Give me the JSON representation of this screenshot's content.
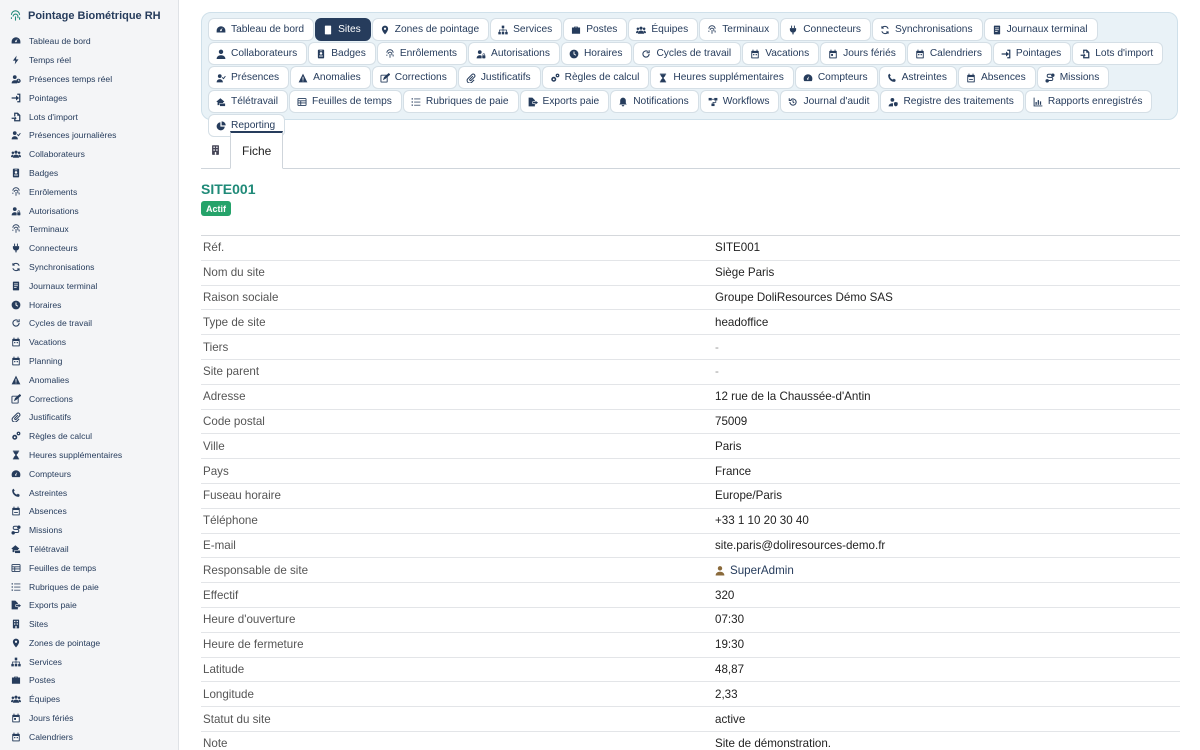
{
  "app": {
    "title": "Pointage Biométrique RH",
    "accent": "#263c5c",
    "brand_color": "#1f8a78"
  },
  "sidebar": {
    "items": [
      {
        "label": "Tableau de bord",
        "icon": "dashboard-icon"
      },
      {
        "label": "Temps réel",
        "icon": "bolt-icon"
      },
      {
        "label": "Présences temps réel",
        "icon": "user-clock-icon"
      },
      {
        "label": "Pointages",
        "icon": "sign-in-icon"
      },
      {
        "label": "Lots d'import",
        "icon": "file-import-icon"
      },
      {
        "label": "Présences journalières",
        "icon": "user-check-icon"
      },
      {
        "label": "Collaborateurs",
        "icon": "users-icon"
      },
      {
        "label": "Badges",
        "icon": "id-badge-icon"
      },
      {
        "label": "Enrôlements",
        "icon": "fingerprint-icon"
      },
      {
        "label": "Autorisations",
        "icon": "user-lock-icon"
      },
      {
        "label": "Terminaux",
        "icon": "fingerprint-icon"
      },
      {
        "label": "Connecteurs",
        "icon": "plug-icon"
      },
      {
        "label": "Synchronisations",
        "icon": "sync-icon"
      },
      {
        "label": "Journaux terminal",
        "icon": "terminal-log-icon"
      },
      {
        "label": "Horaires",
        "icon": "clock-icon"
      },
      {
        "label": "Cycles de travail",
        "icon": "redo-icon"
      },
      {
        "label": "Vacations",
        "icon": "calendar-icon"
      },
      {
        "label": "Planning",
        "icon": "calendar-icon"
      },
      {
        "label": "Anomalies",
        "icon": "warning-icon"
      },
      {
        "label": "Corrections",
        "icon": "edit-icon"
      },
      {
        "label": "Justificatifs",
        "icon": "paperclip-icon"
      },
      {
        "label": "Règles de calcul",
        "icon": "cogs-icon"
      },
      {
        "label": "Heures supplémentaires",
        "icon": "hourglass-icon"
      },
      {
        "label": "Compteurs",
        "icon": "gauge-icon"
      },
      {
        "label": "Astreintes",
        "icon": "phone-icon"
      },
      {
        "label": "Absences",
        "icon": "calendar-minus-icon"
      },
      {
        "label": "Missions",
        "icon": "route-icon"
      },
      {
        "label": "Télétravail",
        "icon": "home-laptop-icon"
      },
      {
        "label": "Feuilles de temps",
        "icon": "table-icon"
      },
      {
        "label": "Rubriques de paie",
        "icon": "list-icon"
      },
      {
        "label": "Exports paie",
        "icon": "file-export-icon"
      },
      {
        "label": "Sites",
        "icon": "building-icon"
      },
      {
        "label": "Zones de pointage",
        "icon": "map-marker-icon"
      },
      {
        "label": "Services",
        "icon": "sitemap-icon"
      },
      {
        "label": "Postes",
        "icon": "briefcase-icon"
      },
      {
        "label": "Équipes",
        "icon": "users-icon"
      },
      {
        "label": "Jours fériés",
        "icon": "calendar-day-icon"
      },
      {
        "label": "Calendriers",
        "icon": "calendar-icon"
      }
    ]
  },
  "tabs": [
    {
      "label": "Tableau de bord",
      "icon": "dashboard-icon",
      "active": false
    },
    {
      "label": "Sites",
      "icon": "building-icon",
      "active": true
    },
    {
      "label": "Zones de pointage",
      "icon": "map-marker-icon",
      "active": false
    },
    {
      "label": "Services",
      "icon": "sitemap-icon",
      "active": false
    },
    {
      "label": "Postes",
      "icon": "briefcase-icon",
      "active": false
    },
    {
      "label": "Équipes",
      "icon": "users-icon",
      "active": false
    },
    {
      "label": "Terminaux",
      "icon": "fingerprint-icon",
      "active": false
    },
    {
      "label": "Connecteurs",
      "icon": "plug-icon",
      "active": false
    },
    {
      "label": "Synchronisations",
      "icon": "sync-icon",
      "active": false
    },
    {
      "label": "Journaux terminal",
      "icon": "terminal-log-icon",
      "active": false
    },
    {
      "label": "Collaborateurs",
      "icon": "user-icon",
      "active": false
    },
    {
      "label": "Badges",
      "icon": "id-badge-icon",
      "active": false
    },
    {
      "label": "Enrôlements",
      "icon": "fingerprint-icon",
      "active": false
    },
    {
      "label": "Autorisations",
      "icon": "user-lock-icon",
      "active": false
    },
    {
      "label": "Horaires",
      "icon": "clock-icon",
      "active": false
    },
    {
      "label": "Cycles de travail",
      "icon": "redo-icon",
      "active": false
    },
    {
      "label": "Vacations",
      "icon": "calendar-icon",
      "active": false
    },
    {
      "label": "Jours fériés",
      "icon": "calendar-day-icon",
      "active": false
    },
    {
      "label": "Calendriers",
      "icon": "calendar-icon",
      "active": false
    },
    {
      "label": "Pointages",
      "icon": "sign-in-icon",
      "active": false
    },
    {
      "label": "Lots d'import",
      "icon": "file-import-icon",
      "active": false
    },
    {
      "label": "Présences",
      "icon": "user-check-icon",
      "active": false
    },
    {
      "label": "Anomalies",
      "icon": "warning-icon",
      "active": false
    },
    {
      "label": "Corrections",
      "icon": "edit-icon",
      "active": false
    },
    {
      "label": "Justificatifs",
      "icon": "paperclip-icon",
      "active": false
    },
    {
      "label": "Règles de calcul",
      "icon": "cogs-icon",
      "active": false
    },
    {
      "label": "Heures supplémentaires",
      "icon": "hourglass-icon",
      "active": false
    },
    {
      "label": "Compteurs",
      "icon": "gauge-icon",
      "active": false
    },
    {
      "label": "Astreintes",
      "icon": "phone-icon",
      "active": false
    },
    {
      "label": "Absences",
      "icon": "calendar-minus-icon",
      "active": false
    },
    {
      "label": "Missions",
      "icon": "route-icon",
      "active": false
    },
    {
      "label": "Télétravail",
      "icon": "home-laptop-icon",
      "active": false
    },
    {
      "label": "Feuilles de temps",
      "icon": "table-icon",
      "active": false
    },
    {
      "label": "Rubriques de paie",
      "icon": "list-icon",
      "active": false
    },
    {
      "label": "Exports paie",
      "icon": "file-export-icon",
      "active": false
    },
    {
      "label": "Notifications",
      "icon": "bell-icon",
      "active": false
    },
    {
      "label": "Workflows",
      "icon": "workflow-icon",
      "active": false
    },
    {
      "label": "Journal d'audit",
      "icon": "history-icon",
      "active": false
    },
    {
      "label": "Registre des traitements",
      "icon": "user-shield-icon",
      "active": false
    },
    {
      "label": "Rapports enregistrés",
      "icon": "chart-icon",
      "active": false
    },
    {
      "label": "Reporting",
      "icon": "pie-icon",
      "active": false
    }
  ],
  "subtabs": {
    "icon": "building-icon",
    "fiche_label": "Fiche"
  },
  "record": {
    "ref": "SITE001",
    "status": "Actif",
    "status_color": "#25a36a",
    "fields": [
      {
        "label": "Réf.",
        "value": "SITE001"
      },
      {
        "label": "Nom du site",
        "value": "Siège Paris"
      },
      {
        "label": "Raison sociale",
        "value": "Groupe DoliResources Démo SAS"
      },
      {
        "label": "Type de site",
        "value": "headoffice"
      },
      {
        "label": "Tiers",
        "value": "-",
        "dim": true
      },
      {
        "label": "Site parent",
        "value": "-",
        "dim": true
      },
      {
        "label": "Adresse",
        "value": "12 rue de la Chaussée-d'Antin"
      },
      {
        "label": "Code postal",
        "value": "75009"
      },
      {
        "label": "Ville",
        "value": "Paris"
      },
      {
        "label": "Pays",
        "value": "France"
      },
      {
        "label": "Fuseau horaire",
        "value": "Europe/Paris"
      },
      {
        "label": "Téléphone",
        "value": "+33 1 10 20 30 40"
      },
      {
        "label": "E-mail",
        "value": "site.paris@doliresources-demo.fr"
      },
      {
        "label": "Responsable de site",
        "value": "SuperAdmin",
        "link": true,
        "icon": "user-icon"
      },
      {
        "label": "Effectif",
        "value": "320"
      },
      {
        "label": "Heure d'ouverture",
        "value": "07:30"
      },
      {
        "label": "Heure de fermeture",
        "value": "19:30"
      },
      {
        "label": "Latitude",
        "value": "48,87"
      },
      {
        "label": "Longitude",
        "value": "2,33"
      },
      {
        "label": "Statut du site",
        "value": "active"
      },
      {
        "label": "Note",
        "value": "Site de démonstration."
      }
    ]
  }
}
